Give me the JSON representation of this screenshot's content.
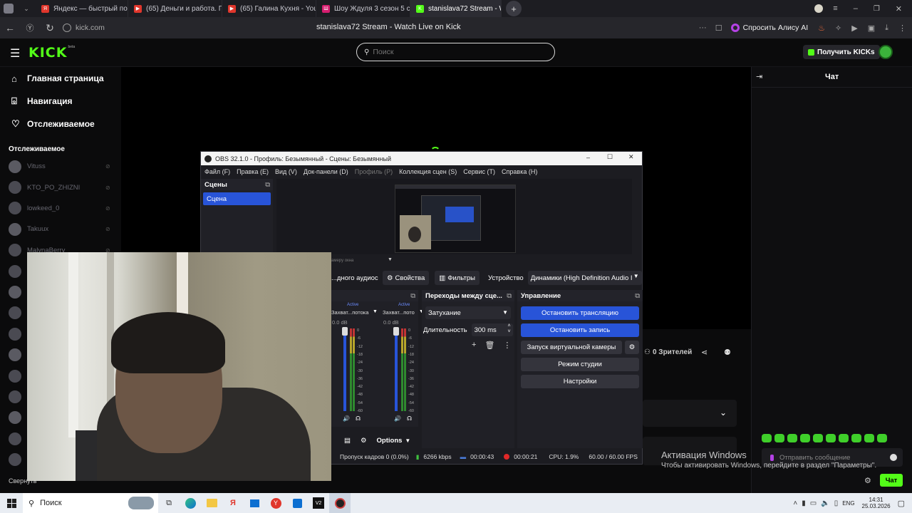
{
  "browser": {
    "tabs": [
      {
        "label": "Яндекс — быстрый поиск",
        "color": "#e0362c",
        "letter": "Я"
      },
      {
        "label": "(65) Деньги и работа. Пр",
        "color": "#e0362c",
        "letter": "▶"
      },
      {
        "label": "(65) Галина Кухня - YouTu",
        "color": "#e0362c",
        "letter": "▶"
      },
      {
        "label": "Шоу Ждуля 3 сезон 5 се",
        "color": "#d61d6f",
        "letter": "Ш"
      },
      {
        "label": "stanislava72 Stream - W",
        "color": "#53fc18",
        "letter": "K"
      }
    ],
    "url": "kick.com",
    "page_title": "stanislava72 Stream - Watch Live on Kick",
    "alice_label": "Спросить Алису AI"
  },
  "kick": {
    "logo": "KICK",
    "logo_badge": "beta",
    "search_placeholder": "Поиск",
    "get_kicks": "Получить KICKs",
    "nav": [
      {
        "label": "Главная страница",
        "icon": "home-icon"
      },
      {
        "label": "Навигация",
        "icon": "compass-icon"
      },
      {
        "label": "Отслеживаемое",
        "icon": "heart-icon"
      }
    ],
    "following_header": "Отслеживаемое",
    "following": [
      "Vituss",
      "KTO_PO_ZHIZNI",
      "lowkeed_0",
      "Takuux",
      "MalynaBerry"
    ],
    "collapse": "Свернуть",
    "viewers": "0 Зрителей",
    "chat_title": "Чат",
    "chat_placeholder": "Отправить сообщение",
    "chat_button": "Чат"
  },
  "obs": {
    "title": "OBS 32.1.0 - Профиль: Безымянный - Сцены: Безымянный",
    "menu": [
      "Файл (F)",
      "Правка (E)",
      "Вид (V)",
      "Док-панели (D)",
      "Профиль (P)",
      "Коллекция сцен (S)",
      "Сервис (T)",
      "Справка (H)"
    ],
    "scenes_title": "Сцены",
    "scene_item": "Сцена",
    "source_caption": "...амеру окна",
    "audio_label": "...дного аудиос",
    "properties": "Свойства",
    "filters": "Фильтры",
    "device_label": "Устройство",
    "device_value": "Динамики (High Definition Audio I",
    "mixer": {
      "ch1": "Захват...потока",
      "ch2": "Захват...пото",
      "active": "Active",
      "db": "0.0 dB",
      "scale": [
        "0",
        "-6",
        "-12",
        "-18",
        "-24",
        "-30",
        "-36",
        "-42",
        "-48",
        "-54",
        "-60"
      ],
      "options": "Options"
    },
    "transitions": {
      "title": "Переходы между сце...",
      "type": "Затухание",
      "duration_label": "Длительность",
      "duration": "300 ms"
    },
    "controls": {
      "title": "Управление",
      "stop_stream": "Остановить трансляцию",
      "stop_rec": "Остановить запись",
      "virtual_cam": "Запуск виртуальной камеры",
      "studio": "Режим студии",
      "settings": "Настройки"
    },
    "status": {
      "dropped": "Пропуск кадров 0 (0.0%)",
      "kbps": "6266 kbps",
      "stream_time": "00:00:43",
      "rec_time": "00:00:21",
      "cpu": "CPU: 1.9%",
      "fps": "60.00 / 60.00 FPS"
    }
  },
  "windows": {
    "activation_title": "Активация Windows",
    "activation_text": "Чтобы активировать Windows, перейдите в раздел \"Параметры\".",
    "search": "Поиск",
    "lang": "ENG",
    "time": "14:31",
    "date": "25.03.2026"
  }
}
